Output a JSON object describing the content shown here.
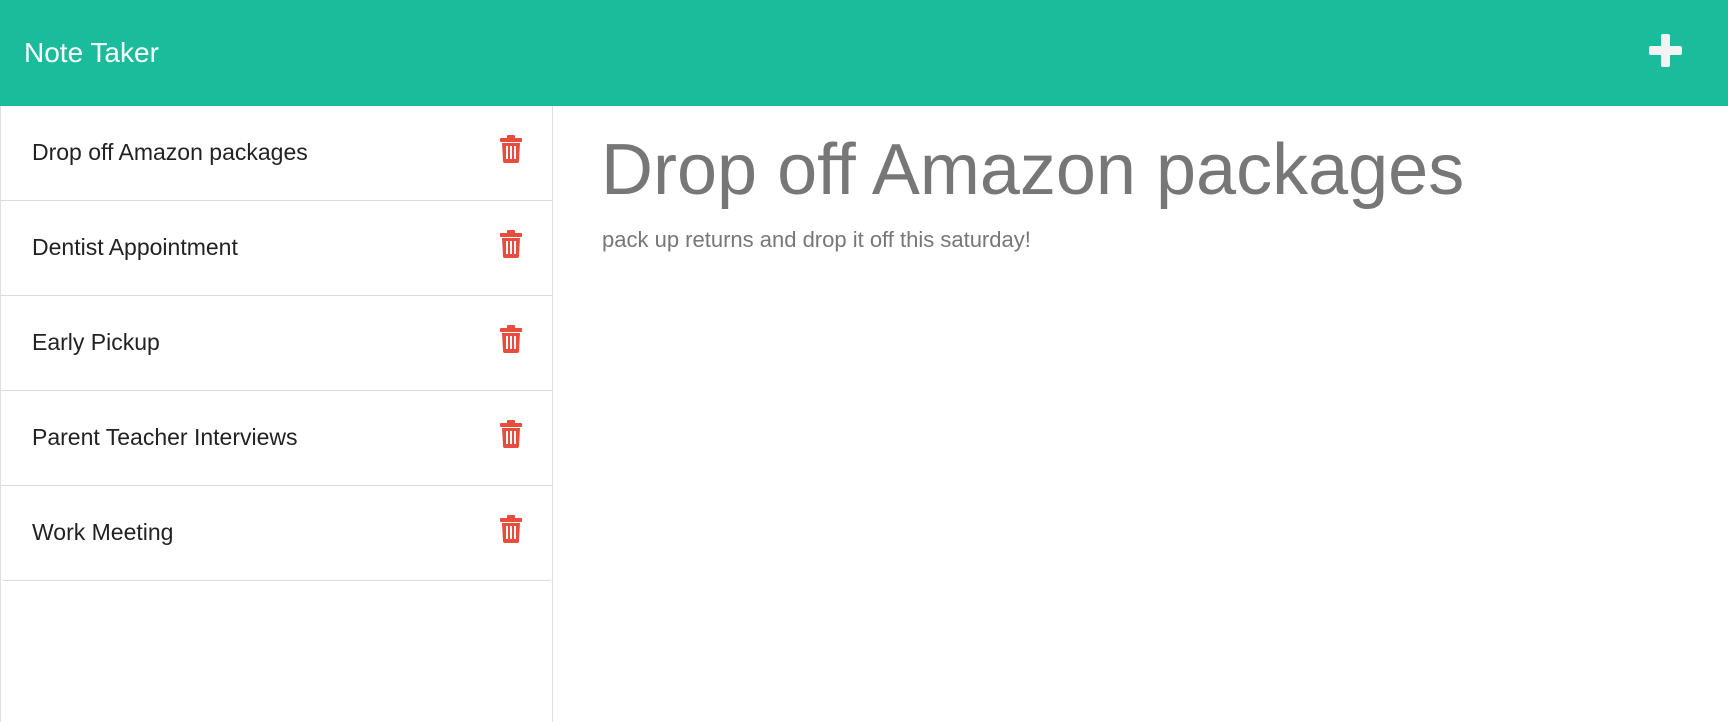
{
  "app": {
    "title": "Note Taker",
    "accent_color": "#1abc9c",
    "delete_color": "#e74c3c"
  },
  "header": {
    "new_note_icon": "plus-icon"
  },
  "sidebar": {
    "delete_icon": "trash-icon",
    "items": [
      {
        "label": "Drop off Amazon packages"
      },
      {
        "label": "Dentist Appointment"
      },
      {
        "label": "Early Pickup"
      },
      {
        "label": "Parent Teacher Interviews"
      },
      {
        "label": "Work Meeting"
      }
    ]
  },
  "main": {
    "note_title": "Drop off Amazon packages",
    "note_text": "pack up returns and drop it off this saturday!"
  }
}
